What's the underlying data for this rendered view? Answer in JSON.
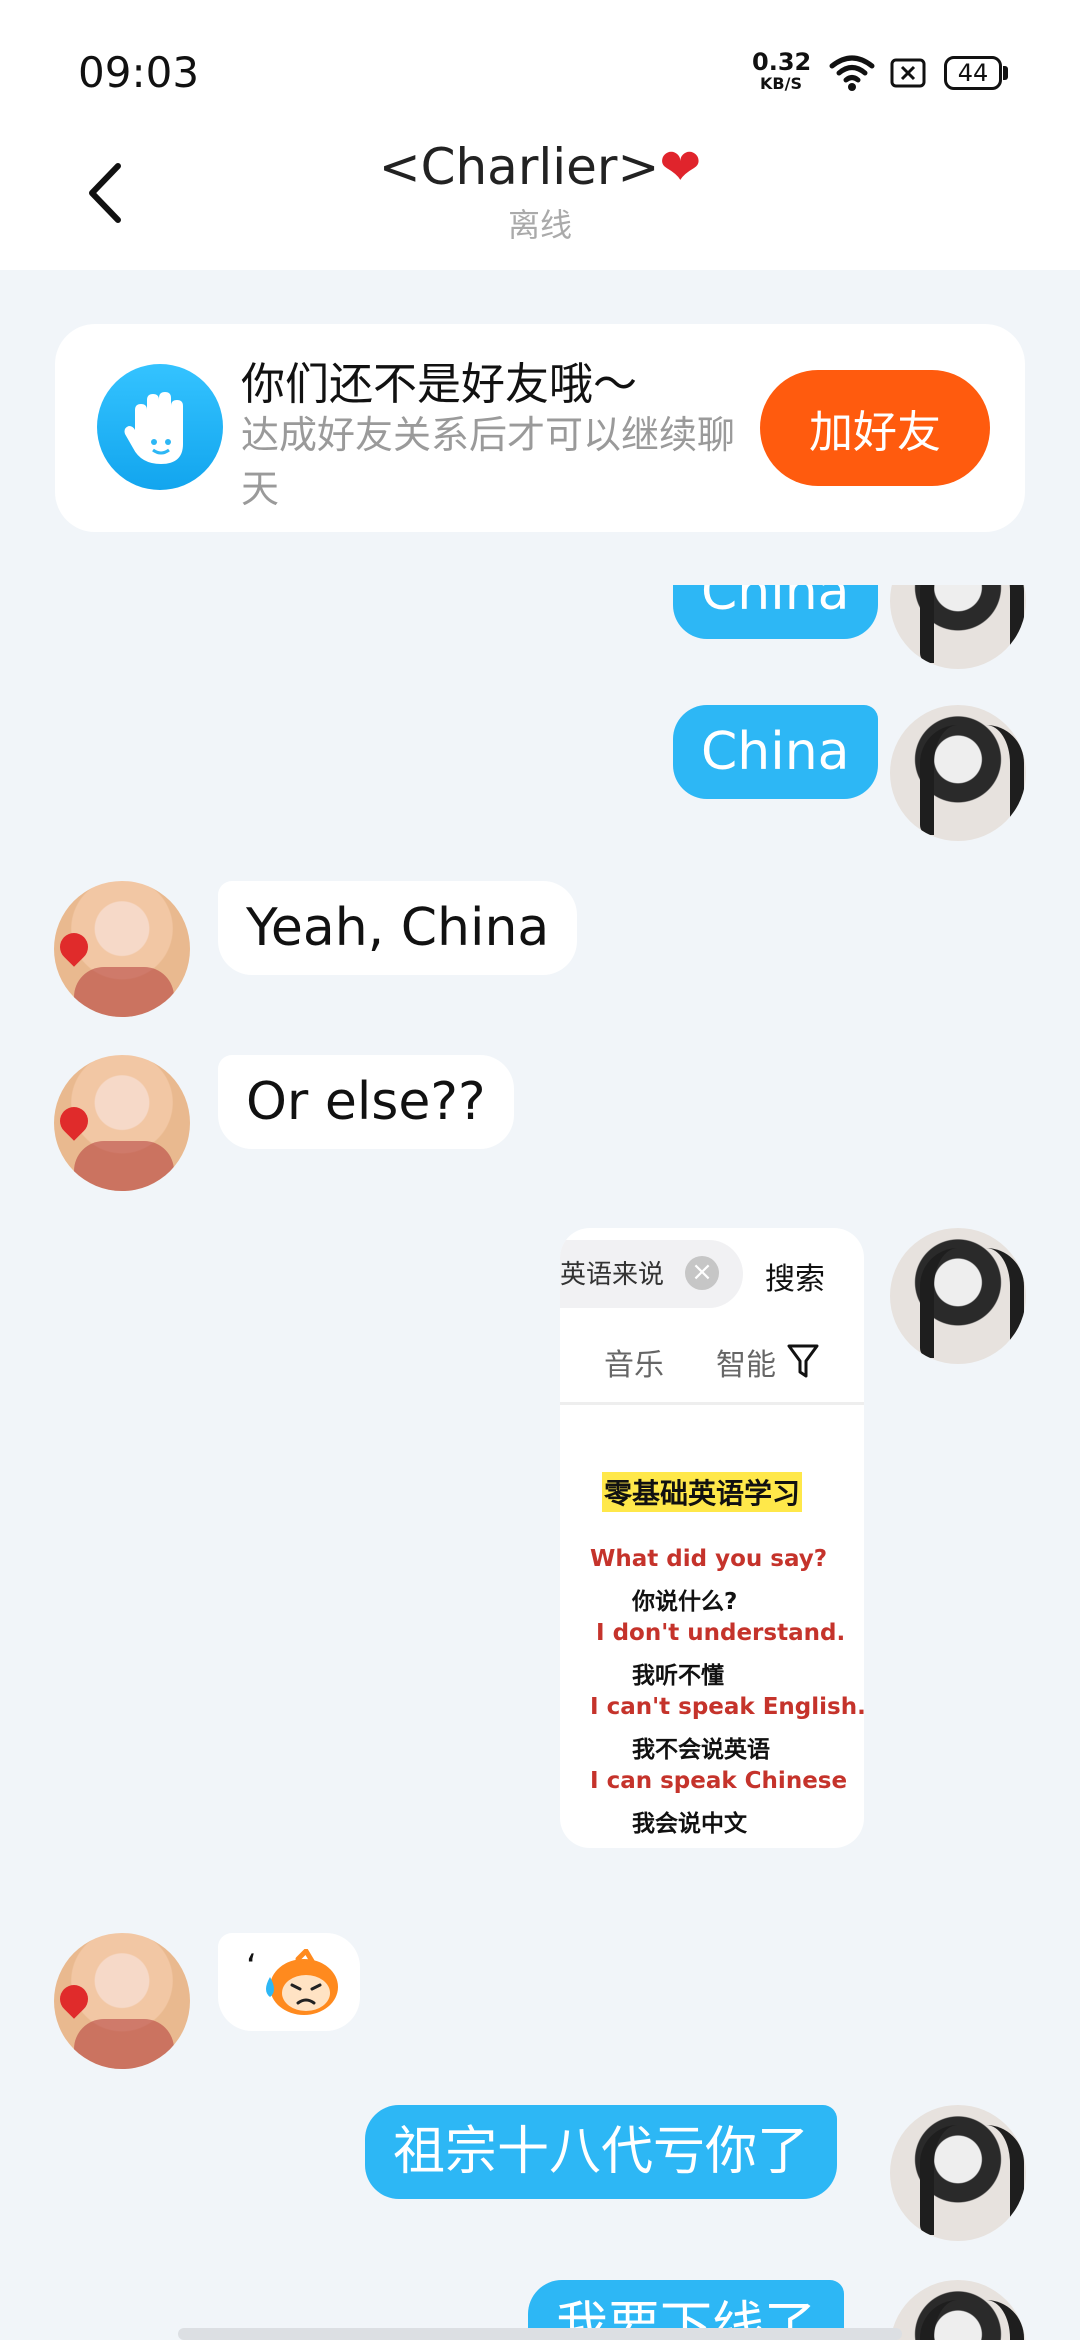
{
  "status_bar": {
    "time": "09:03",
    "net_speed": "0.32",
    "net_unit": "KB/S",
    "battery": "44"
  },
  "header": {
    "contact_name": "<Charlier>",
    "heart": "❤",
    "status": "离线"
  },
  "notice": {
    "title": "你们还不是好友哦～",
    "subtitle": "达成好友关系后才可以继续聊天",
    "button": "加好友"
  },
  "messages": [
    {
      "from": "me",
      "text": "China"
    },
    {
      "from": "me",
      "text": "China"
    },
    {
      "from": "other",
      "text": "Yeah, China"
    },
    {
      "from": "other",
      "text": "Or else??"
    },
    {
      "from": "me",
      "type": "image"
    },
    {
      "from": "other",
      "type": "sticker",
      "text": "‘"
    },
    {
      "from": "me",
      "text": "祖宗十八代亏你了"
    },
    {
      "from": "me",
      "text": "我要下线了"
    }
  ],
  "image_message": {
    "search_text": "英语来说",
    "clear": "×",
    "search_button": "搜索",
    "tab_music": "音乐",
    "tab_smart": "智能",
    "title": "零基础英语学习",
    "lines": [
      {
        "en": "What did you say?",
        "cn": "你说什么?"
      },
      {
        "en": "I don't understand.",
        "cn": "我听不懂"
      },
      {
        "en": "I can't speak English.",
        "cn": "我不会说英语"
      },
      {
        "en": "I can speak Chinese",
        "cn": "我会说中文"
      }
    ]
  },
  "colors": {
    "my_bubble": "#2db7f5",
    "add_friend_button": "#ff5b0e",
    "background": "#f1f5f9"
  }
}
